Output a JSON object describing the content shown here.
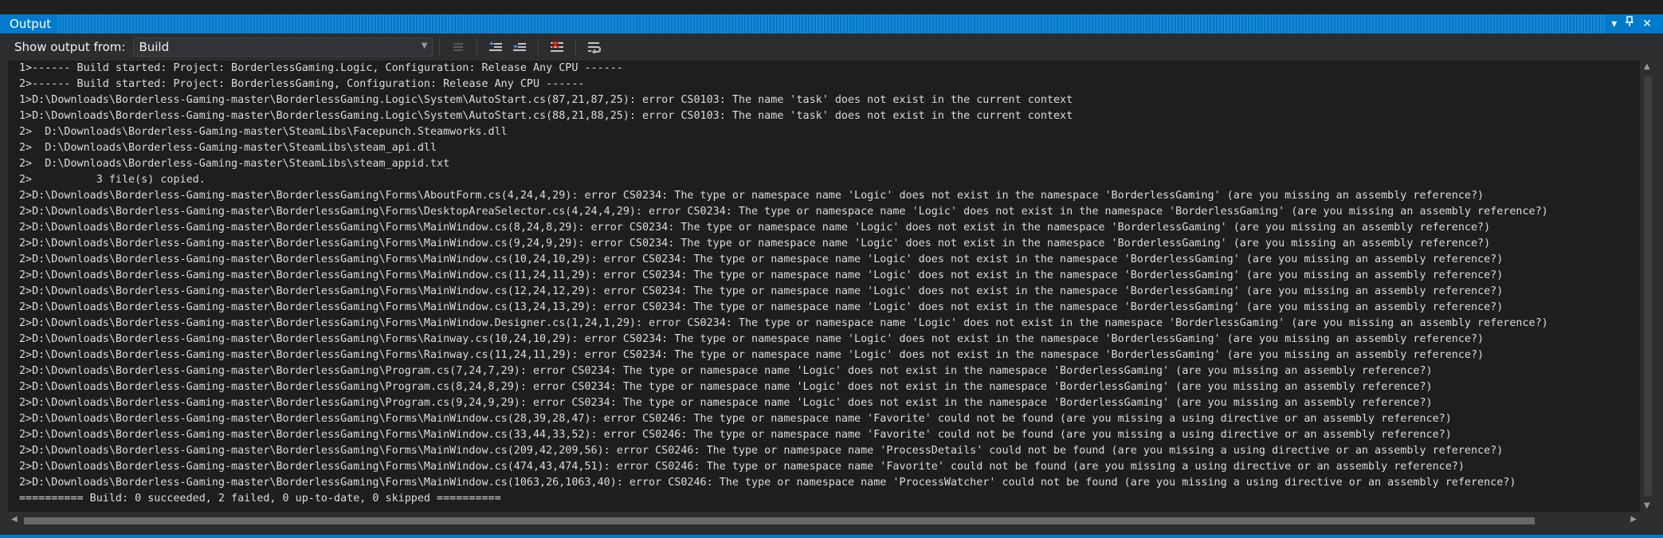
{
  "panel": {
    "title": "Output",
    "controls": [
      "chevron-down-icon",
      "pin-icon",
      "close-icon"
    ]
  },
  "toolbar": {
    "show_output_label": "Show output from:",
    "source_selected": "Build",
    "buttons": [
      "go-to-current-icon",
      "previous-message-icon",
      "next-message-icon",
      "clear-all-icon",
      "toggle-word-wrap-icon"
    ]
  },
  "colors": {
    "accent": "#007acc",
    "background": "#1e1e1e",
    "toolbar": "#2d2d30",
    "text": "#dcdcdc"
  },
  "output": {
    "lines": [
      "1>------ Build started: Project: BorderlessGaming.Logic, Configuration: Release Any CPU ------",
      "2>------ Build started: Project: BorderlessGaming, Configuration: Release Any CPU ------",
      "1>D:\\Downloads\\Borderless-Gaming-master\\BorderlessGaming.Logic\\System\\AutoStart.cs(87,21,87,25): error CS0103: The name 'task' does not exist in the current context",
      "1>D:\\Downloads\\Borderless-Gaming-master\\BorderlessGaming.Logic\\System\\AutoStart.cs(88,21,88,25): error CS0103: The name 'task' does not exist in the current context",
      "2>  D:\\Downloads\\Borderless-Gaming-master\\SteamLibs\\Facepunch.Steamworks.dll",
      "2>  D:\\Downloads\\Borderless-Gaming-master\\SteamLibs\\steam_api.dll",
      "2>  D:\\Downloads\\Borderless-Gaming-master\\SteamLibs\\steam_appid.txt",
      "2>          3 file(s) copied.",
      "2>D:\\Downloads\\Borderless-Gaming-master\\BorderlessGaming\\Forms\\AboutForm.cs(4,24,4,29): error CS0234: The type or namespace name 'Logic' does not exist in the namespace 'BorderlessGaming' (are you missing an assembly reference?)",
      "2>D:\\Downloads\\Borderless-Gaming-master\\BorderlessGaming\\Forms\\DesktopAreaSelector.cs(4,24,4,29): error CS0234: The type or namespace name 'Logic' does not exist in the namespace 'BorderlessGaming' (are you missing an assembly reference?)",
      "2>D:\\Downloads\\Borderless-Gaming-master\\BorderlessGaming\\Forms\\MainWindow.cs(8,24,8,29): error CS0234: The type or namespace name 'Logic' does not exist in the namespace 'BorderlessGaming' (are you missing an assembly reference?)",
      "2>D:\\Downloads\\Borderless-Gaming-master\\BorderlessGaming\\Forms\\MainWindow.cs(9,24,9,29): error CS0234: The type or namespace name 'Logic' does not exist in the namespace 'BorderlessGaming' (are you missing an assembly reference?)",
      "2>D:\\Downloads\\Borderless-Gaming-master\\BorderlessGaming\\Forms\\MainWindow.cs(10,24,10,29): error CS0234: The type or namespace name 'Logic' does not exist in the namespace 'BorderlessGaming' (are you missing an assembly reference?)",
      "2>D:\\Downloads\\Borderless-Gaming-master\\BorderlessGaming\\Forms\\MainWindow.cs(11,24,11,29): error CS0234: The type or namespace name 'Logic' does not exist in the namespace 'BorderlessGaming' (are you missing an assembly reference?)",
      "2>D:\\Downloads\\Borderless-Gaming-master\\BorderlessGaming\\Forms\\MainWindow.cs(12,24,12,29): error CS0234: The type or namespace name 'Logic' does not exist in the namespace 'BorderlessGaming' (are you missing an assembly reference?)",
      "2>D:\\Downloads\\Borderless-Gaming-master\\BorderlessGaming\\Forms\\MainWindow.cs(13,24,13,29): error CS0234: The type or namespace name 'Logic' does not exist in the namespace 'BorderlessGaming' (are you missing an assembly reference?)",
      "2>D:\\Downloads\\Borderless-Gaming-master\\BorderlessGaming\\Forms\\MainWindow.Designer.cs(1,24,1,29): error CS0234: The type or namespace name 'Logic' does not exist in the namespace 'BorderlessGaming' (are you missing an assembly reference?)",
      "2>D:\\Downloads\\Borderless-Gaming-master\\BorderlessGaming\\Forms\\Rainway.cs(10,24,10,29): error CS0234: The type or namespace name 'Logic' does not exist in the namespace 'BorderlessGaming' (are you missing an assembly reference?)",
      "2>D:\\Downloads\\Borderless-Gaming-master\\BorderlessGaming\\Forms\\Rainway.cs(11,24,11,29): error CS0234: The type or namespace name 'Logic' does not exist in the namespace 'BorderlessGaming' (are you missing an assembly reference?)",
      "2>D:\\Downloads\\Borderless-Gaming-master\\BorderlessGaming\\Program.cs(7,24,7,29): error CS0234: The type or namespace name 'Logic' does not exist in the namespace 'BorderlessGaming' (are you missing an assembly reference?)",
      "2>D:\\Downloads\\Borderless-Gaming-master\\BorderlessGaming\\Program.cs(8,24,8,29): error CS0234: The type or namespace name 'Logic' does not exist in the namespace 'BorderlessGaming' (are you missing an assembly reference?)",
      "2>D:\\Downloads\\Borderless-Gaming-master\\BorderlessGaming\\Program.cs(9,24,9,29): error CS0234: The type or namespace name 'Logic' does not exist in the namespace 'BorderlessGaming' (are you missing an assembly reference?)",
      "2>D:\\Downloads\\Borderless-Gaming-master\\BorderlessGaming\\Forms\\MainWindow.cs(28,39,28,47): error CS0246: The type or namespace name 'Favorite' could not be found (are you missing a using directive or an assembly reference?)",
      "2>D:\\Downloads\\Borderless-Gaming-master\\BorderlessGaming\\Forms\\MainWindow.cs(33,44,33,52): error CS0246: The type or namespace name 'Favorite' could not be found (are you missing a using directive or an assembly reference?)",
      "2>D:\\Downloads\\Borderless-Gaming-master\\BorderlessGaming\\Forms\\MainWindow.cs(209,42,209,56): error CS0246: The type or namespace name 'ProcessDetails' could not be found (are you missing a using directive or an assembly reference?)",
      "2>D:\\Downloads\\Borderless-Gaming-master\\BorderlessGaming\\Forms\\MainWindow.cs(474,43,474,51): error CS0246: The type or namespace name 'Favorite' could not be found (are you missing a using directive or an assembly reference?)",
      "2>D:\\Downloads\\Borderless-Gaming-master\\BorderlessGaming\\Forms\\MainWindow.cs(1063,26,1063,40): error CS0246: The type or namespace name 'ProcessWatcher' could not be found (are you missing a using directive or an assembly reference?)",
      "========== Build: 0 succeeded, 2 failed, 0 up-to-date, 0 skipped =========="
    ]
  }
}
